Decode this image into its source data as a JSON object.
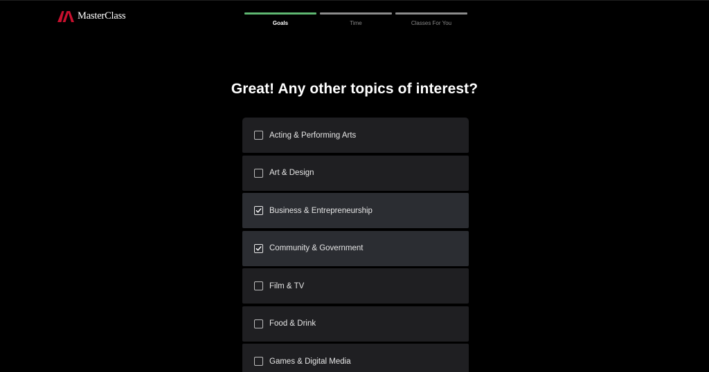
{
  "brand": {
    "name": "MasterClass",
    "logo_icon": "masterclass-m-icon",
    "logo_color": "#c8102e"
  },
  "progress": {
    "steps": [
      {
        "label": "Goals",
        "active": true
      },
      {
        "label": "Time",
        "active": false
      },
      {
        "label": "Classes For You",
        "active": false
      }
    ],
    "active_color": "#5fb872",
    "inactive_color": "#8c8c8c"
  },
  "main": {
    "heading": "Great! Any other topics of interest?"
  },
  "topics": [
    {
      "label": "Acting & Performing Arts",
      "checked": false
    },
    {
      "label": "Art & Design",
      "checked": false
    },
    {
      "label": "Business & Entrepreneurship",
      "checked": true
    },
    {
      "label": "Community & Government",
      "checked": true
    },
    {
      "label": "Film & TV",
      "checked": false
    },
    {
      "label": "Food & Drink",
      "checked": false
    },
    {
      "label": "Games & Digital Media",
      "checked": false
    }
  ],
  "icons": {
    "checkbox_checked": "checkmark-icon"
  }
}
